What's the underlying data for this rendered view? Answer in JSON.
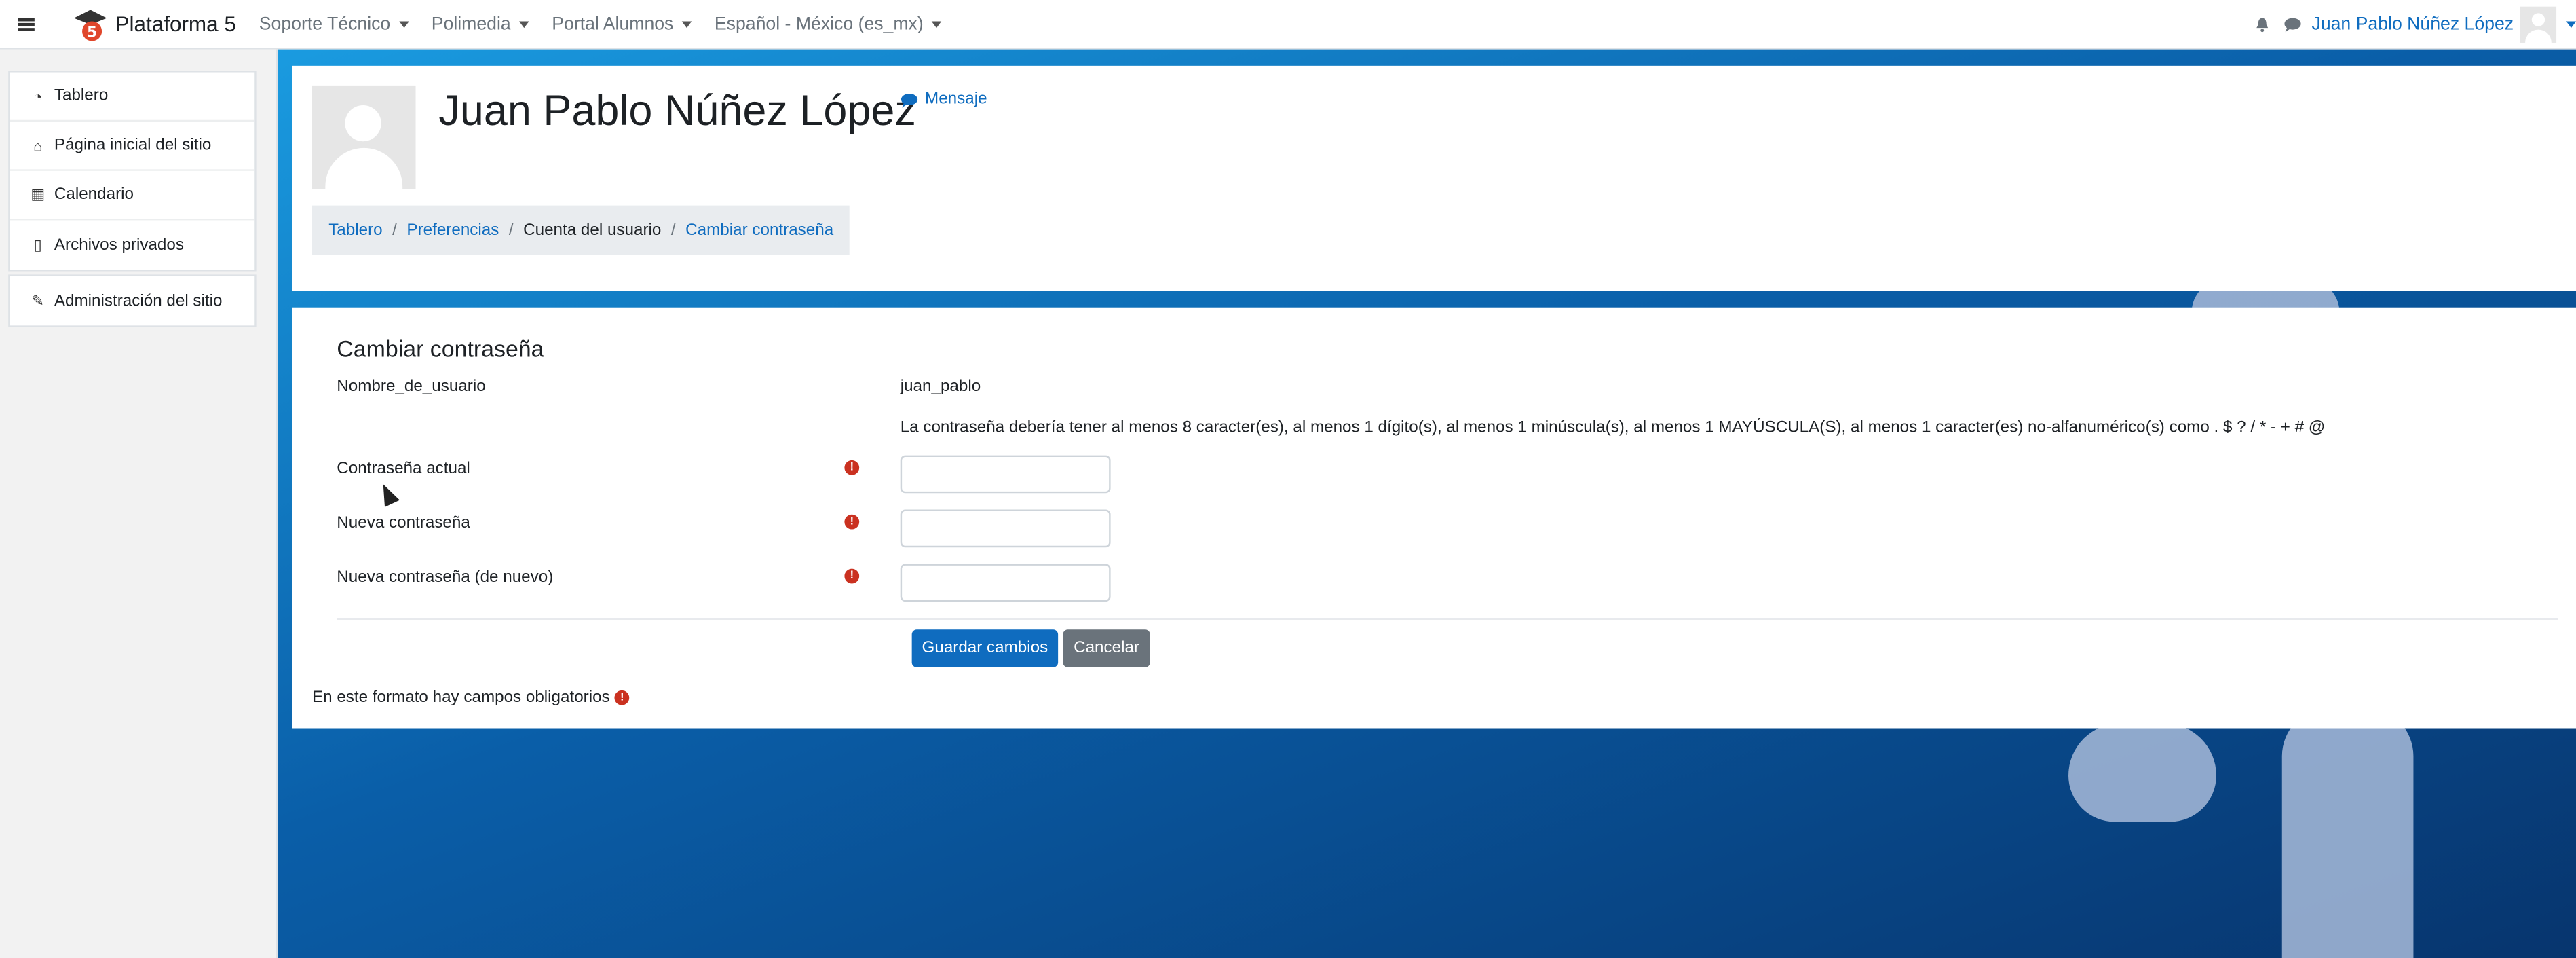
{
  "navbar": {
    "brand": "Plataforma 5",
    "menus": [
      "Soporte Técnico",
      "Polimedia",
      "Portal Alumnos",
      "Español - México (es_mx)"
    ],
    "user_name": "Juan Pablo Núñez López",
    "icons": [
      "bell-icon",
      "comment-icon"
    ]
  },
  "sidebar": {
    "items": [
      {
        "label": "Tablero",
        "icon": "dashboard-icon"
      },
      {
        "label": "Página inicial del sitio",
        "icon": "home-icon"
      },
      {
        "label": "Calendario",
        "icon": "calendar-icon"
      },
      {
        "label": "Archivos privados",
        "icon": "file-icon"
      }
    ],
    "admin": {
      "label": "Administración del sitio",
      "icon": "wrench-icon"
    }
  },
  "header": {
    "title": "Juan Pablo Núñez López",
    "message_label": "Mensaje",
    "breadcrumb": [
      "Tablero",
      "Preferencias",
      "Cuenta del usuario",
      "Cambiar contraseña"
    ]
  },
  "form": {
    "title": "Cambiar contraseña",
    "username_label": "Nombre_de_usuario",
    "username_value": "juan_pablo",
    "policy": "La contraseña debería tener al menos 8 caracter(es), al menos 1 dígito(s), al menos 1 minúscula(s), al menos 1 MAYÚSCULA(S), al menos 1 caracter(es) no-alfanumérico(s) como . $ ? / * - + # @",
    "current_label": "Contraseña actual",
    "new_label": "Nueva contraseña",
    "new_again_label": "Nueva contraseña (de nuevo)",
    "save_label": "Guardar cambios",
    "cancel_label": "Cancelar",
    "required_note": "En este formato hay campos obligatorios",
    "required_glyph": "!"
  },
  "colors": {
    "accent": "#0f6cbf",
    "required": "#ca3120",
    "background_blue": "#0a5ea8"
  }
}
